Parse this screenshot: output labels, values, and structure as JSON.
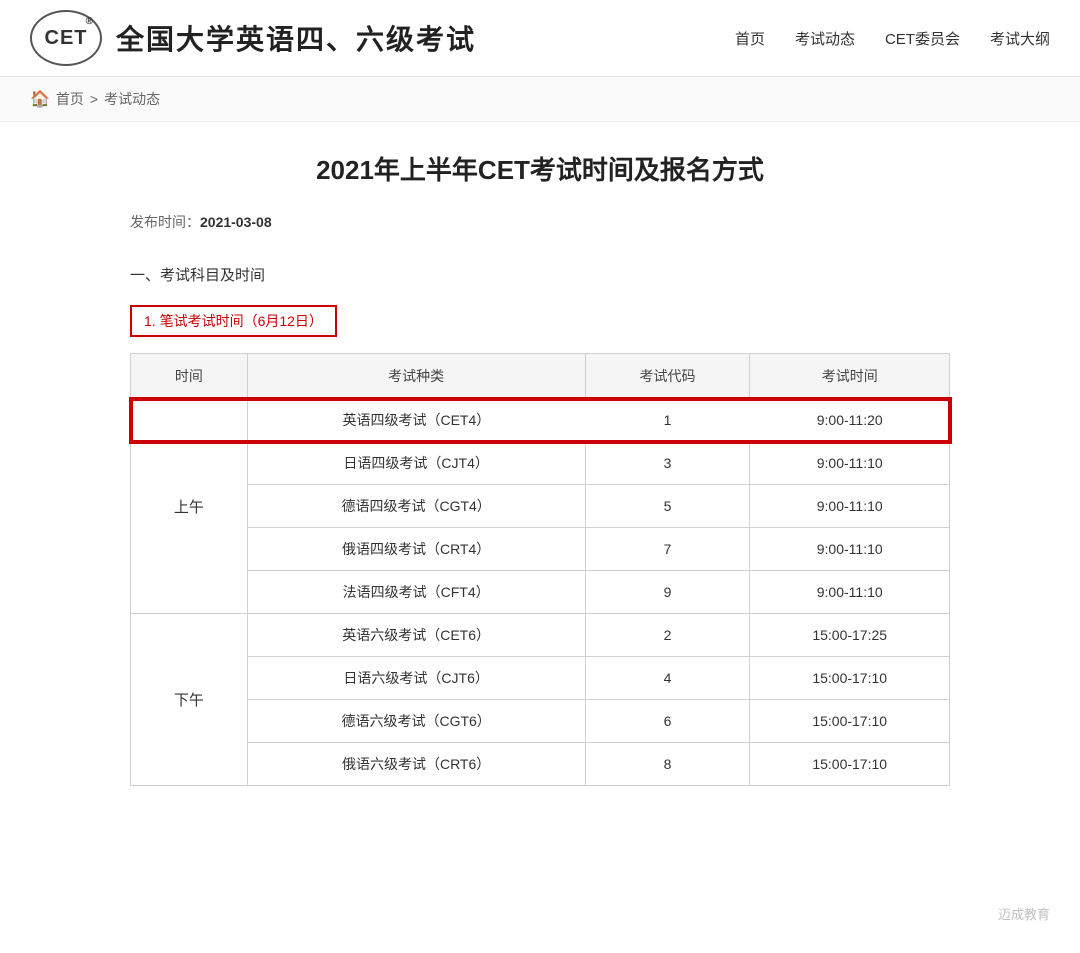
{
  "header": {
    "logo_text": "CET",
    "site_title": "全国大学英语四、六级考试",
    "nav": [
      {
        "label": "首页",
        "id": "nav-home"
      },
      {
        "label": "考试动态",
        "id": "nav-news"
      },
      {
        "label": "CET委员会",
        "id": "nav-committee"
      },
      {
        "label": "考试大纲",
        "id": "nav-syllabus"
      }
    ]
  },
  "breadcrumb": {
    "home": "首页",
    "separator": ">",
    "current": "考试动态"
  },
  "article": {
    "title": "2021年上半年CET考试时间及报名方式",
    "publish_label": "发布时间：",
    "publish_date": "2021-03-08",
    "section1_title": "一、考试科目及时间",
    "subsection1_title": "1. 笔试考试时间（6月12日）",
    "table": {
      "headers": [
        "时间",
        "考试种类",
        "考试代码",
        "考试时间"
      ],
      "rows": [
        {
          "period": "上午",
          "rowspan": 5,
          "exams": [
            {
              "name": "英语四级考试（CET4）",
              "code": "1",
              "time": "9:00-11:20",
              "highlight": true
            },
            {
              "name": "日语四级考试（CJT4）",
              "code": "3",
              "time": "9:00-11:10",
              "highlight": false
            },
            {
              "name": "德语四级考试（CGT4）",
              "code": "5",
              "time": "9:00-11:10",
              "highlight": false
            },
            {
              "name": "俄语四级考试（CRT4）",
              "code": "7",
              "time": "9:00-11:10",
              "highlight": false
            },
            {
              "name": "法语四级考试（CFT4）",
              "code": "9",
              "time": "9:00-11:10",
              "highlight": false
            }
          ]
        },
        {
          "period": "下午",
          "rowspan": 4,
          "exams": [
            {
              "name": "英语六级考试（CET6）",
              "code": "2",
              "time": "15:00-17:25",
              "highlight": false
            },
            {
              "name": "日语六级考试（CJT6）",
              "code": "4",
              "time": "15:00-17:10",
              "highlight": false
            },
            {
              "name": "德语六级考试（CGT6）",
              "code": "6",
              "time": "15:00-17:10",
              "highlight": false
            },
            {
              "name": "俄语六级考试（CRT6）",
              "code": "8",
              "time": "15:00-17:10",
              "highlight": false
            }
          ]
        }
      ]
    }
  },
  "watermark": {
    "text": "迈成教育"
  }
}
